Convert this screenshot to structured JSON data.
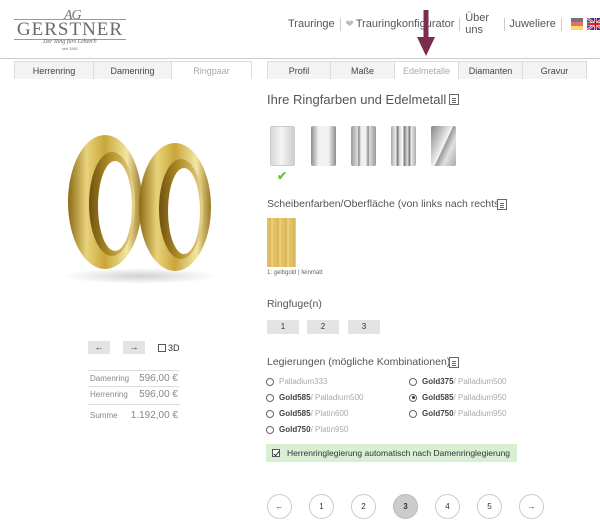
{
  "brand": {
    "initials": "AG",
    "name": "GERSTNER",
    "slogan": "Der Ring fürs Leben®",
    "since": "seit 1862"
  },
  "nav": {
    "items": [
      "Trauringe",
      "Trauringkonfigurator",
      "Über uns",
      "Juweliere"
    ]
  },
  "accent": "#7b2d4f",
  "tabs_left": [
    "Herrenring",
    "Damenring",
    "Ringpaar"
  ],
  "tabs_right": [
    "Profil",
    "Maße",
    "Edelmetalle",
    "Diamanten",
    "Gravur"
  ],
  "view": {
    "prev": "←",
    "next": "→",
    "label_3d": "3D"
  },
  "prices": [
    {
      "label": "Damenring",
      "value": "596,00 €"
    },
    {
      "label": "Herrenring",
      "value": "596,00 €"
    },
    {
      "label": "Summe",
      "value": "1.192,00 €"
    }
  ],
  "section_colors": {
    "title": "Ihre Ringfarben und Edelmetall"
  },
  "section_surface": {
    "title": "Scheibenfarben/Oberfläche (von links nach rechts)",
    "swatch_label": "1: gelbgold | feinmatt"
  },
  "section_fuge": {
    "title": "Ringfuge(n)",
    "options": [
      "1",
      "2",
      "3"
    ]
  },
  "section_alloy": {
    "title": "Legierungen (mögliche Kombinationen)",
    "left": [
      {
        "main": "",
        "sub": "Palladium333",
        "selected": false
      },
      {
        "main": "Gold585",
        "sub": " / Palladium500",
        "selected": false
      },
      {
        "main": "Gold585",
        "sub": " / Platin600",
        "selected": false
      },
      {
        "main": "Gold750",
        "sub": " / Platin950",
        "selected": false
      }
    ],
    "right": [
      {
        "main": "Gold375",
        "sub": " / Palladium500",
        "selected": false
      },
      {
        "main": "Gold585",
        "sub": " / Palladium950",
        "selected": true
      },
      {
        "main": "Gold750",
        "sub": " / Palladium950",
        "selected": false
      }
    ]
  },
  "auto_option": {
    "label": "Herrenringlegierung automatisch nach Damenringlegierung",
    "checked": true
  },
  "pagination": {
    "prev": "←",
    "pages": [
      "1",
      "2",
      "3",
      "4",
      "5"
    ],
    "current": "3",
    "next": "→"
  }
}
